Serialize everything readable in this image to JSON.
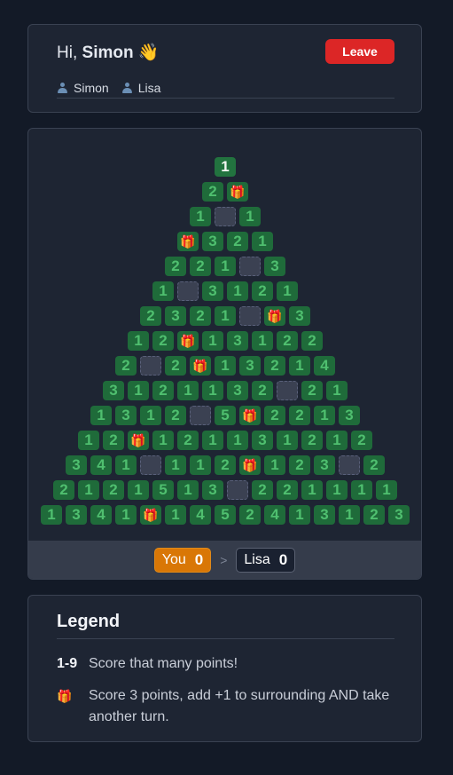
{
  "header": {
    "greeting_prefix": "Hi,",
    "user_name": "Simon",
    "greeting_emoji": "👋",
    "leave_label": "Leave",
    "players": [
      "Simon",
      "Lisa"
    ]
  },
  "board": {
    "rows": [
      [
        "1"
      ],
      [
        "2",
        "gift"
      ],
      [
        "1",
        "empty",
        "1"
      ],
      [
        "gift",
        "3",
        "2",
        "1"
      ],
      [
        "2",
        "2",
        "1",
        "empty",
        "3"
      ],
      [
        "1",
        "empty",
        "3",
        "1",
        "2",
        "1"
      ],
      [
        "2",
        "3",
        "2",
        "1",
        "empty",
        "gift",
        "3"
      ],
      [
        "1",
        "2",
        "gift",
        "1",
        "3",
        "1",
        "2",
        "2"
      ],
      [
        "2",
        "empty",
        "2",
        "gift",
        "1",
        "3",
        "2",
        "1",
        "4"
      ],
      [
        "3",
        "1",
        "2",
        "1",
        "1",
        "3",
        "2",
        "empty",
        "2",
        "1"
      ],
      [
        "1",
        "3",
        "1",
        "2",
        "empty",
        "5",
        "gift",
        "2",
        "2",
        "1",
        "3"
      ],
      [
        "1",
        "2",
        "gift",
        "1",
        "2",
        "1",
        "1",
        "3",
        "1",
        "2",
        "1",
        "2"
      ],
      [
        "3",
        "4",
        "1",
        "empty",
        "1",
        "1",
        "2",
        "gift",
        "1",
        "2",
        "3",
        "empty",
        "2"
      ],
      [
        "2",
        "1",
        "2",
        "1",
        "5",
        "1",
        "3",
        "empty",
        "2",
        "2",
        "1",
        "1",
        "1",
        "1"
      ],
      [
        "1",
        "3",
        "4",
        "1",
        "gift",
        "1",
        "4",
        "5",
        "2",
        "4",
        "1",
        "3",
        "1",
        "2",
        "3"
      ]
    ],
    "gift_icon": "🎁"
  },
  "scores": {
    "you_label": "You",
    "you_score": "0",
    "separator": ">",
    "opponent_label": "Lisa",
    "opponent_score": "0"
  },
  "legend": {
    "title": "Legend",
    "items": [
      {
        "key": "1-9",
        "text": "Score that many points!"
      },
      {
        "key": "🎁",
        "text": "Score 3 points, add +1 to surrounding AND take another turn."
      }
    ]
  },
  "colors": {
    "background": "#131a27",
    "card": "#1e2533",
    "cell_green": "#1f6b3a",
    "cell_text": "#4fbf6f",
    "leave_red": "#dc2626",
    "you_orange": "#d97706"
  }
}
